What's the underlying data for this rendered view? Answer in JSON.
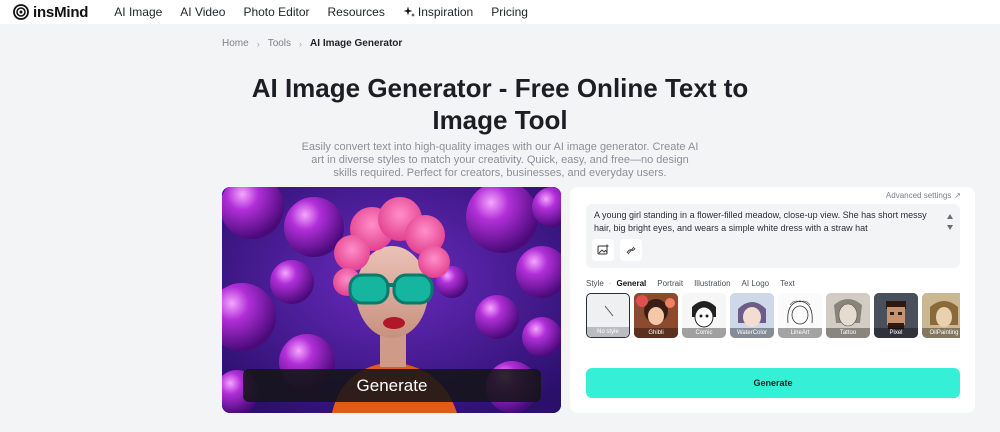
{
  "nav": {
    "brand": "insMind",
    "items": [
      {
        "label": "AI Image"
      },
      {
        "label": "AI Video"
      },
      {
        "label": "Photo Editor"
      },
      {
        "label": "Resources"
      },
      {
        "label": "Inspiration",
        "icon": "sparkle-icon"
      },
      {
        "label": "Pricing"
      }
    ]
  },
  "breadcrumb": [
    "Home",
    "Tools",
    "AI Image Generator"
  ],
  "page": {
    "title": "AI Image Generator - Free Online Text to Image Tool",
    "subtitle": "Easily convert text into high-quality images with our AI image generator. Create AI art in diverse styles to match your creativity. Quick, easy, and free—no design skills required. Perfect for creators, businesses, and everyday users."
  },
  "hero": {
    "button_label": "Generate"
  },
  "panel": {
    "advanced_settings": "Advanced settings",
    "prompt": "A young girl standing in a flower-filled meadow, close-up view. She has short messy hair, big bright eyes, and wears a simple white dress with a straw hat",
    "style_label": "Style",
    "style_tabs": [
      "General",
      "Portrait",
      "Illustration",
      "AI Logo",
      "Text"
    ],
    "active_style_tab": "General",
    "styles": [
      {
        "label": "No style",
        "selected": true
      },
      {
        "label": "Ghibli"
      },
      {
        "label": "Comic"
      },
      {
        "label": "WaterColor"
      },
      {
        "label": "LineArt"
      },
      {
        "label": "Tattoo"
      },
      {
        "label": "Pixel"
      },
      {
        "label": "OilPainting"
      }
    ],
    "generate_label": "Generate"
  },
  "colors": {
    "accent": "#35f0d6",
    "hero_bg": "#4b1b9c",
    "page_bg": "#f3f4f6"
  }
}
